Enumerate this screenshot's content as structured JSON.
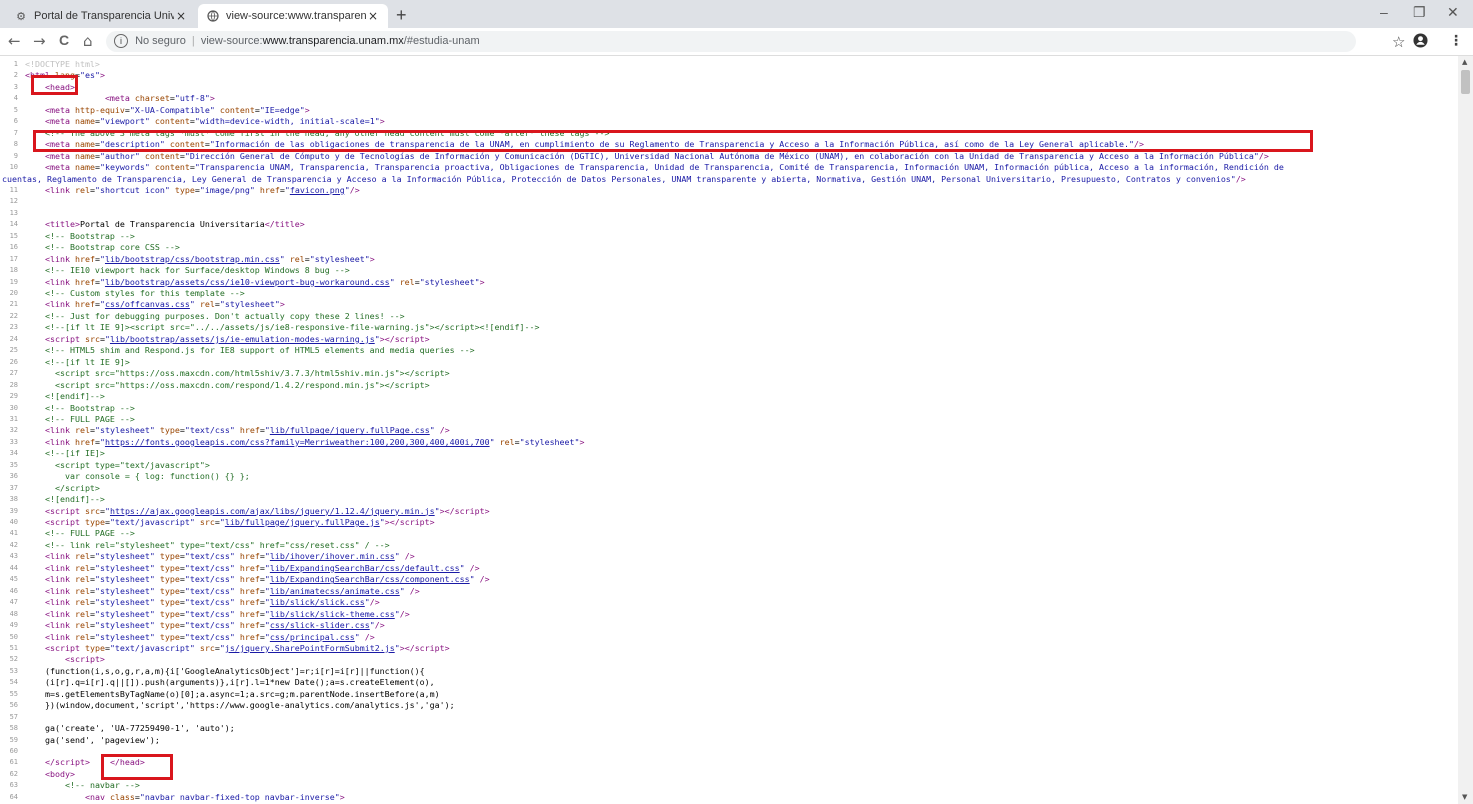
{
  "tabs": [
    {
      "title": "Portal de Transparencia Universit",
      "close": "×",
      "favicon": "gear-icon"
    },
    {
      "title": "view-source:www.transparencia.u",
      "close": "×",
      "favicon": "globe-icon"
    }
  ],
  "new_tab": "+",
  "window": {
    "minimize": "–",
    "maximize": "❐",
    "close": "✕"
  },
  "nav": {
    "back": "←",
    "forward": "→",
    "reload": "C",
    "home": "⌂"
  },
  "omnibox": {
    "info": "i",
    "security": "No seguro",
    "separator": "|",
    "scheme": "view-source:",
    "host": "www.transparencia.unam.mx",
    "path": "/#estudia-unam"
  },
  "toolbar_icons": {
    "star": "☆",
    "account": "👤",
    "menu": "⋮"
  },
  "source_lines": [
    {
      "n": "1",
      "html": "<span class='c-doc'>&lt;!DOCTYPE html&gt;</span>"
    },
    {
      "n": "2",
      "html": "<span class='c-tag'>&lt;html</span> <span class='c-attr'>lang</span>=<span class='c-val'>\"es\"</span><span class='c-tag'>&gt;</span>"
    },
    {
      "n": "3",
      "html": "    <span class='c-tag'>&lt;head&gt;</span>"
    },
    {
      "n": "4",
      "html": "                <span class='c-tag'>&lt;meta</span> <span class='c-attr'>charset</span>=<span class='c-val'>\"utf-8\"</span><span class='c-tag'>&gt;</span>"
    },
    {
      "n": "5",
      "html": "    <span class='c-tag'>&lt;meta</span> <span class='c-attr'>http-equiv</span>=<span class='c-val'>\"X-UA-Compatible\"</span> <span class='c-attr'>content</span>=<span class='c-val'>\"IE=edge\"</span><span class='c-tag'>&gt;</span>"
    },
    {
      "n": "6",
      "html": "    <span class='c-tag'>&lt;meta</span> <span class='c-attr'>name</span>=<span class='c-val'>\"viewport\"</span> <span class='c-attr'>content</span>=<span class='c-val'>\"width=device-width, initial-scale=1\"</span><span class='c-tag'>&gt;</span>"
    },
    {
      "n": "7",
      "html": "    <span class='c-com'>&lt;!-- The above 3 meta tags *must* come first in the head; any other head content must come *after* these tags --&gt;</span>"
    },
    {
      "n": "8",
      "html": "    <span class='c-tag'>&lt;meta</span> <span class='c-attr'>name</span>=<span class='c-val'>\"description\"</span> <span class='c-attr'>content</span>=<span class='c-val'>\"Información de las obligaciones de transparencia de la UNAM, en cumplimiento de su Reglamento de Transparencia y Acceso a la Información Pública, así como de la Ley General aplicable.\"</span><span class='c-tag'>/&gt;</span>"
    },
    {
      "n": "9",
      "html": "    <span class='c-tag'>&lt;meta</span> <span class='c-attr'>name</span>=<span class='c-val'>\"author\"</span> <span class='c-attr'>content</span>=<span class='c-val'>\"Dirección General de Cómputo y de Tecnologías de Información y Comunicación (DGTIC), Universidad Nacional Autónoma de México (UNAM), en colaboración con la Unidad de Transparencia y Acceso a la Información Pública\"</span><span class='c-tag'>/&gt;</span>"
    },
    {
      "n": "10",
      "html": "    <span class='c-tag'>&lt;meta</span> <span class='c-attr'>name</span>=<span class='c-val'>\"keywords\"</span> <span class='c-attr'>content</span>=<span class='c-val'>\"Transparencia UNAM, Transparencia, Transparencia proactiva, Obligaciones de Transparencia, Unidad de Transparencia, Comité de Transparencia, Información UNAM, Información pública, Acceso a la información, Rendición de</span>"
    },
    {
      "n": "",
      "html": "<span class='c-val'>cuentas, Reglamento de Transparencia, Ley General de Transparencia y Acceso a la Información Pública, Protección de Datos Personales, UNAM transparente y abierta, Normativa, Gestión UNAM, Personal Universitario, Presupuesto, Contratos y convenios\"</span><span class='c-tag'>/&gt;</span>",
      "wrap": true
    },
    {
      "n": "11",
      "html": "    <span class='c-tag'>&lt;link</span> <span class='c-attr'>rel</span>=<span class='c-val'>\"shortcut icon\"</span> <span class='c-attr'>type</span>=<span class='c-val'>\"image/png\"</span> <span class='c-attr'>href</span>=<span class='c-val'>\"</span><span class='c-link'>favicon.png</span><span class='c-val'>\"</span><span class='c-tag'>/&gt;</span>"
    },
    {
      "n": "12",
      "html": ""
    },
    {
      "n": "13",
      "html": ""
    },
    {
      "n": "14",
      "html": "    <span class='c-tag'>&lt;title&gt;</span><span class='c-txt'>Portal de Transparencia Universitaria</span><span class='c-tag'>&lt;/title&gt;</span>"
    },
    {
      "n": "15",
      "html": "    <span class='c-com'>&lt;!-- Bootstrap --&gt;</span>"
    },
    {
      "n": "16",
      "html": "    <span class='c-com'>&lt;!-- Bootstrap core CSS --&gt;</span>"
    },
    {
      "n": "17",
      "html": "    <span class='c-tag'>&lt;link</span> <span class='c-attr'>href</span>=<span class='c-val'>\"</span><span class='c-link'>lib/bootstrap/css/bootstrap.min.css</span><span class='c-val'>\"</span> <span class='c-attr'>rel</span>=<span class='c-val'>\"stylesheet\"</span><span class='c-tag'>&gt;</span>"
    },
    {
      "n": "18",
      "html": "    <span class='c-com'>&lt;!-- IE10 viewport hack for Surface/desktop Windows 8 bug --&gt;</span>"
    },
    {
      "n": "19",
      "html": "    <span class='c-tag'>&lt;link</span> <span class='c-attr'>href</span>=<span class='c-val'>\"</span><span class='c-link'>lib/bootstrap/assets/css/ie10-viewport-bug-workaround.css</span><span class='c-val'>\"</span> <span class='c-attr'>rel</span>=<span class='c-val'>\"stylesheet\"</span><span class='c-tag'>&gt;</span>"
    },
    {
      "n": "20",
      "html": "    <span class='c-com'>&lt;!-- Custom styles for this template --&gt;</span>"
    },
    {
      "n": "21",
      "html": "    <span class='c-tag'>&lt;link</span> <span class='c-attr'>href</span>=<span class='c-val'>\"</span><span class='c-link'>css/offcanvas.css</span><span class='c-val'>\"</span> <span class='c-attr'>rel</span>=<span class='c-val'>\"stylesheet\"</span><span class='c-tag'>&gt;</span>"
    },
    {
      "n": "22",
      "html": "    <span class='c-com'>&lt;!-- Just for debugging purposes. Don't actually copy these 2 lines! --&gt;</span>"
    },
    {
      "n": "23",
      "html": "    <span class='c-com'>&lt;!--[if lt IE 9]&gt;&lt;script src=\"../../assets/js/ie8-responsive-file-warning.js\"&gt;&lt;/script&gt;&lt;![endif]--&gt;</span>"
    },
    {
      "n": "24",
      "html": "    <span class='c-tag'>&lt;script</span> <span class='c-attr'>src</span>=<span class='c-val'>\"</span><span class='c-link'>lib/bootstrap/assets/js/ie-emulation-modes-warning.js</span><span class='c-val'>\"</span><span class='c-tag'>&gt;&lt;/script&gt;</span>"
    },
    {
      "n": "25",
      "html": "    <span class='c-com'>&lt;!-- HTML5 shim and Respond.js for IE8 support of HTML5 elements and media queries --&gt;</span>"
    },
    {
      "n": "26",
      "html": "    <span class='c-com'>&lt;!--[if lt IE 9]&gt;</span>"
    },
    {
      "n": "27",
      "html": "<span class='c-com'>      &lt;script src=\"https://oss.maxcdn.com/html5shiv/3.7.3/html5shiv.min.js\"&gt;&lt;/script&gt;</span>"
    },
    {
      "n": "28",
      "html": "<span class='c-com'>      &lt;script src=\"https://oss.maxcdn.com/respond/1.4.2/respond.min.js\"&gt;&lt;/script&gt;</span>"
    },
    {
      "n": "29",
      "html": "<span class='c-com'>    &lt;![endif]--&gt;</span>"
    },
    {
      "n": "30",
      "html": "    <span class='c-com'>&lt;!-- Bootstrap --&gt;</span>"
    },
    {
      "n": "31",
      "html": "    <span class='c-com'>&lt;!-- FULL PAGE --&gt;</span>"
    },
    {
      "n": "32",
      "html": "    <span class='c-tag'>&lt;link</span> <span class='c-attr'>rel</span>=<span class='c-val'>\"stylesheet\"</span> <span class='c-attr'>type</span>=<span class='c-val'>\"text/css\"</span> <span class='c-attr'>href</span>=<span class='c-val'>\"</span><span class='c-link'>lib/fullpage/jquery.fullPage.css</span><span class='c-val'>\"</span> <span class='c-tag'>/&gt;</span>"
    },
    {
      "n": "33",
      "html": "    <span class='c-tag'>&lt;link</span> <span class='c-attr'>href</span>=<span class='c-val'>\"</span><span class='c-link'>https://fonts.googleapis.com/css?family=Merriweather:100,200,300,400,400i,700</span><span class='c-val'>\"</span> <span class='c-attr'>rel</span>=<span class='c-val'>\"stylesheet\"</span><span class='c-tag'>&gt;</span>"
    },
    {
      "n": "34",
      "html": "    <span class='c-com'>&lt;!--[if IE]&gt;</span>"
    },
    {
      "n": "35",
      "html": "<span class='c-com'>      &lt;script type=\"text/javascript\"&gt;</span>"
    },
    {
      "n": "36",
      "html": "<span class='c-com'>        var console = { log: function() {} };</span>"
    },
    {
      "n": "37",
      "html": "<span class='c-com'>      &lt;/script&gt;</span>"
    },
    {
      "n": "38",
      "html": "<span class='c-com'>    &lt;![endif]--&gt;</span>"
    },
    {
      "n": "39",
      "html": "    <span class='c-tag'>&lt;script</span> <span class='c-attr'>src</span>=<span class='c-val'>\"</span><span class='c-link'>https://ajax.googleapis.com/ajax/libs/jquery/1.12.4/jquery.min.js</span><span class='c-val'>\"</span><span class='c-tag'>&gt;&lt;/script&gt;</span>"
    },
    {
      "n": "40",
      "html": "    <span class='c-tag'>&lt;script</span> <span class='c-attr'>type</span>=<span class='c-val'>\"text/javascript\"</span> <span class='c-attr'>src</span>=<span class='c-val'>\"</span><span class='c-link'>lib/fullpage/jquery.fullPage.js</span><span class='c-val'>\"</span><span class='c-tag'>&gt;&lt;/script&gt;</span>"
    },
    {
      "n": "41",
      "html": "    <span class='c-com'>&lt;!-- FULL PAGE --&gt;</span>"
    },
    {
      "n": "42",
      "html": "    <span class='c-com'>&lt;!-- link rel=\"stylesheet\" type=\"text/css\" href=\"css/reset.css\" / --&gt;</span>"
    },
    {
      "n": "43",
      "html": "    <span class='c-tag'>&lt;link</span> <span class='c-attr'>rel</span>=<span class='c-val'>\"stylesheet\"</span> <span class='c-attr'>type</span>=<span class='c-val'>\"text/css\"</span> <span class='c-attr'>href</span>=<span class='c-val'>\"</span><span class='c-link'>lib/ihover/ihover.min.css</span><span class='c-val'>\"</span> <span class='c-tag'>/&gt;</span>"
    },
    {
      "n": "44",
      "html": "    <span class='c-tag'>&lt;link</span> <span class='c-attr'>rel</span>=<span class='c-val'>\"stylesheet\"</span> <span class='c-attr'>type</span>=<span class='c-val'>\"text/css\"</span> <span class='c-attr'>href</span>=<span class='c-val'>\"</span><span class='c-link'>lib/ExpandingSearchBar/css/default.css</span><span class='c-val'>\"</span> <span class='c-tag'>/&gt;</span>"
    },
    {
      "n": "45",
      "html": "    <span class='c-tag'>&lt;link</span> <span class='c-attr'>rel</span>=<span class='c-val'>\"stylesheet\"</span> <span class='c-attr'>type</span>=<span class='c-val'>\"text/css\"</span> <span class='c-attr'>href</span>=<span class='c-val'>\"</span><span class='c-link'>lib/ExpandingSearchBar/css/component.css</span><span class='c-val'>\"</span> <span class='c-tag'>/&gt;</span>"
    },
    {
      "n": "46",
      "html": "    <span class='c-tag'>&lt;link</span> <span class='c-attr'>rel</span>=<span class='c-val'>\"stylesheet\"</span> <span class='c-attr'>type</span>=<span class='c-val'>\"text/css\"</span> <span class='c-attr'>href</span>=<span class='c-val'>\"</span><span class='c-link'>lib/animatecss/animate.css</span><span class='c-val'>\"</span> <span class='c-tag'>/&gt;</span>"
    },
    {
      "n": "47",
      "html": "    <span class='c-tag'>&lt;link</span> <span class='c-attr'>rel</span>=<span class='c-val'>\"stylesheet\"</span> <span class='c-attr'>type</span>=<span class='c-val'>\"text/css\"</span> <span class='c-attr'>href</span>=<span class='c-val'>\"</span><span class='c-link'>lib/slick/slick.css</span><span class='c-val'>\"</span><span class='c-tag'>/&gt;</span>"
    },
    {
      "n": "48",
      "html": "    <span class='c-tag'>&lt;link</span> <span class='c-attr'>rel</span>=<span class='c-val'>\"stylesheet\"</span> <span class='c-attr'>type</span>=<span class='c-val'>\"text/css\"</span> <span class='c-attr'>href</span>=<span class='c-val'>\"</span><span class='c-link'>lib/slick/slick-theme.css</span><span class='c-val'>\"</span><span class='c-tag'>/&gt;</span>"
    },
    {
      "n": "49",
      "html": "    <span class='c-tag'>&lt;link</span> <span class='c-attr'>rel</span>=<span class='c-val'>\"stylesheet\"</span> <span class='c-attr'>type</span>=<span class='c-val'>\"text/css\"</span> <span class='c-attr'>href</span>=<span class='c-val'>\"</span><span class='c-link'>css/slick-slider.css</span><span class='c-val'>\"</span><span class='c-tag'>/&gt;</span>"
    },
    {
      "n": "50",
      "html": "    <span class='c-tag'>&lt;link</span> <span class='c-attr'>rel</span>=<span class='c-val'>\"stylesheet\"</span> <span class='c-attr'>type</span>=<span class='c-val'>\"text/css\"</span> <span class='c-attr'>href</span>=<span class='c-val'>\"</span><span class='c-link'>css/principal.css</span><span class='c-val'>\"</span> <span class='c-tag'>/&gt;</span>"
    },
    {
      "n": "51",
      "html": "    <span class='c-tag'>&lt;script</span> <span class='c-attr'>type</span>=<span class='c-val'>\"text/javascript\"</span> <span class='c-attr'>src</span>=<span class='c-val'>\"</span><span class='c-link'>js/jquery.SharePointFormSubmit2.js</span><span class='c-val'>\"</span><span class='c-tag'>&gt;&lt;/script&gt;</span>"
    },
    {
      "n": "52",
      "html": "        <span class='c-tag'>&lt;script&gt;</span>"
    },
    {
      "n": "53",
      "html": "<span class='c-txt'>    (function(i,s,o,g,r,a,m){i['GoogleAnalyticsObject']=r;i[r]=i[r]||function(){</span>"
    },
    {
      "n": "54",
      "html": "<span class='c-txt'>    (i[r].q=i[r].q||[]).push(arguments)},i[r].l=1*new Date();a=s.createElement(o),</span>"
    },
    {
      "n": "55",
      "html": "<span class='c-txt'>    m=s.getElementsByTagName(o)[0];a.async=1;a.src=g;m.parentNode.insertBefore(a,m)</span>"
    },
    {
      "n": "56",
      "html": "<span class='c-txt'>    })(window,document,'script','https://www.google-analytics.com/analytics.js','ga');</span>"
    },
    {
      "n": "57",
      "html": ""
    },
    {
      "n": "58",
      "html": "<span class='c-txt'>    ga('create', 'UA-77259490-1', 'auto');</span>"
    },
    {
      "n": "59",
      "html": "<span class='c-txt'>    ga('send', 'pageview');</span>"
    },
    {
      "n": "60",
      "html": ""
    },
    {
      "n": "61",
      "html": "    <span class='c-tag'>&lt;/script&gt;</span>    <span class='c-tag'>&lt;/head&gt;</span>"
    },
    {
      "n": "62",
      "html": "    <span class='c-tag'>&lt;body&gt;</span>"
    },
    {
      "n": "63",
      "html": "        <span class='c-com'>&lt;!-- navbar --&gt;</span>"
    },
    {
      "n": "64",
      "html": "            <span class='c-tag'>&lt;nav</span> <span class='c-attr'>class</span>=<span class='c-val'>\"navbar navbar-fixed-top navbar-inverse\"</span><span class='c-tag'>&gt;</span>"
    }
  ],
  "scroll_arrows": {
    "up": "▲",
    "down": "▼"
  }
}
